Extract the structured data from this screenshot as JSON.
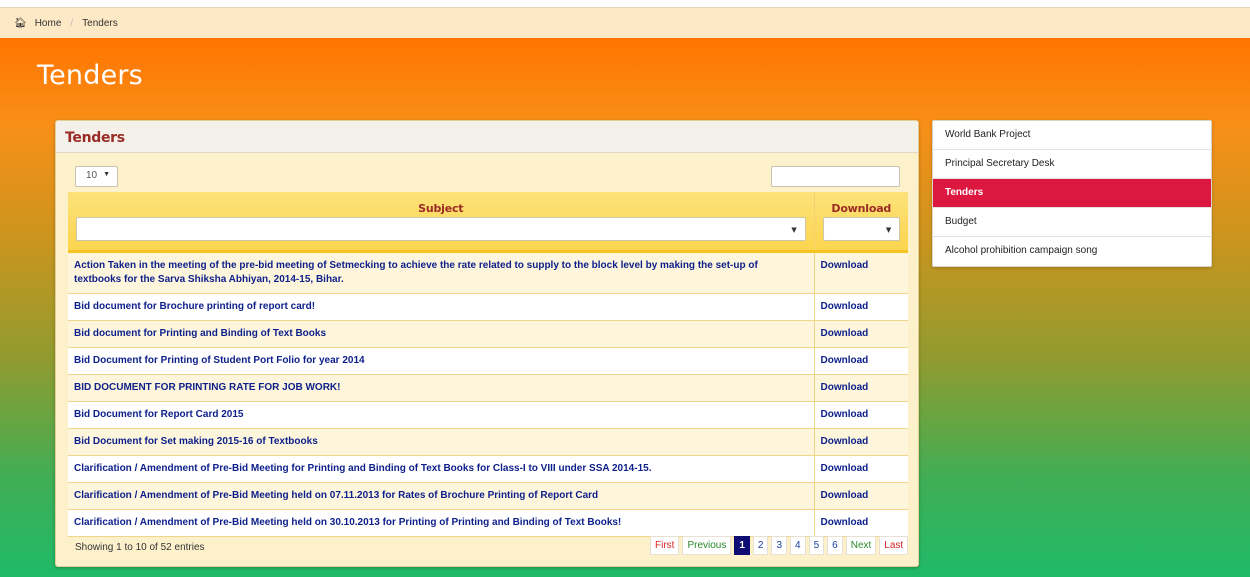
{
  "breadcrumb": {
    "home_icon": "home-icon",
    "home": "Home",
    "current": "Tenders"
  },
  "page": {
    "title": "Tenders"
  },
  "panel": {
    "title": "Tenders",
    "length_value": "10",
    "search_value": ""
  },
  "table": {
    "headers": {
      "subject": "Subject",
      "download": "Download"
    },
    "rows": [
      {
        "subject": "Action Taken in the meeting of the pre-bid meeting of Setmecking to achieve the rate related to supply to the block level by making the set-up of textbooks for the Sarva Shiksha Abhiyan, 2014-15, Bihar.",
        "download": "Download"
      },
      {
        "subject": "Bid document for Brochure printing of report card!",
        "download": "Download"
      },
      {
        "subject": "Bid document for Printing and Binding of Text Books",
        "download": "Download"
      },
      {
        "subject": "Bid Document for Printing of Student Port Folio for year 2014",
        "download": "Download"
      },
      {
        "subject": "BID DOCUMENT FOR PRINTING RATE FOR JOB WORK!",
        "download": "Download"
      },
      {
        "subject": "Bid Document for Report Card 2015",
        "download": "Download"
      },
      {
        "subject": "Bid Document for Set making 2015-16 of Textbooks",
        "download": "Download"
      },
      {
        "subject": "Clarification / Amendment of Pre-Bid Meeting for Printing and Binding of Text Books for Class-I to VIII under SSA 2014-15.",
        "download": "Download"
      },
      {
        "subject": "Clarification / Amendment of Pre-Bid Meeting held on 07.11.2013 for Rates of Brochure Printing of Report Card",
        "download": "Download"
      },
      {
        "subject": "Clarification / Amendment of Pre-Bid Meeting held on 30.10.2013 for Printing of Printing and Binding of Text Books!",
        "download": "Download"
      }
    ]
  },
  "footer": {
    "info": "Showing 1 to 10 of 52 entries",
    "pager": {
      "first": "First",
      "previous": "Previous",
      "pages": [
        "1",
        "2",
        "3",
        "4",
        "5",
        "6"
      ],
      "next": "Next",
      "last": "Last"
    }
  },
  "sidebar": {
    "items": [
      {
        "label": "World Bank Project"
      },
      {
        "label": "Principal Secretary Desk"
      },
      {
        "label": "Tenders",
        "active": true
      },
      {
        "label": "Budget"
      },
      {
        "label": "Alcohol prohibition campaign song"
      }
    ]
  },
  "colors": {
    "accent_red": "#dc1740",
    "title_red": "#9a2b25",
    "link_blue": "#0d1f8a",
    "header_yellow": "#fbd54f",
    "pager_active": "#0c0c72"
  }
}
